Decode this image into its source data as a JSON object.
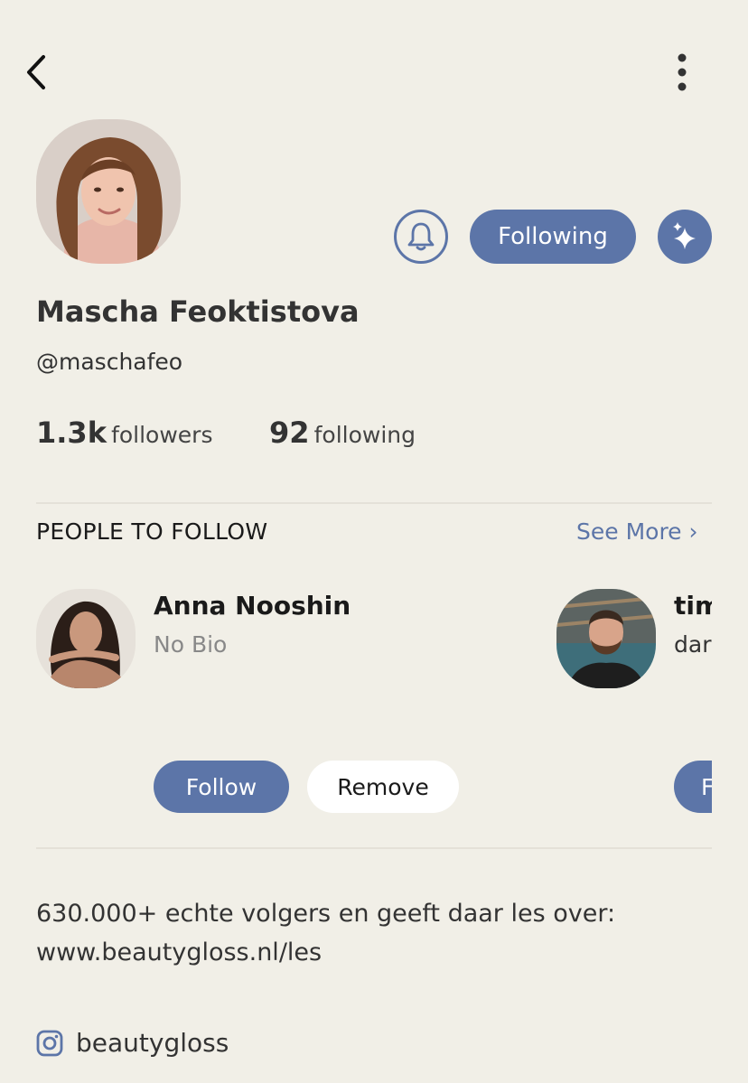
{
  "header": {
    "back_icon": "chevron-left-icon",
    "more_icon": "vertical-dots-icon"
  },
  "profile": {
    "name": "Mascha Feoktistova",
    "username": "@maschafeo",
    "followers_count": "1.3k",
    "followers_label": "followers",
    "following_count": "92",
    "following_label": "following",
    "avatar_icon": "profile-photo"
  },
  "actions": {
    "bell_icon": "bell-icon",
    "following_label": "Following",
    "sparkle_icon": "sparkle-icon"
  },
  "people_to_follow": {
    "title": "PEOPLE TO FOLLOW",
    "see_more": "See More ›",
    "items": [
      {
        "name": "Anna Nooshin",
        "bio": "No Bio"
      },
      {
        "name": "tim",
        "bio": "dar"
      }
    ],
    "follow_label": "Follow",
    "remove_label": "Remove",
    "follow_label_partial": "F"
  },
  "bio": {
    "line1": "630.000+ echte volgers en geeft daar les over:",
    "line2": "www.beautygloss.nl/les"
  },
  "instagram": {
    "icon": "instagram-icon",
    "handle": "beautygloss"
  },
  "colors": {
    "background": "#F1EFE7",
    "accent": "#5C75A8",
    "divider": "#E4E1D8"
  }
}
